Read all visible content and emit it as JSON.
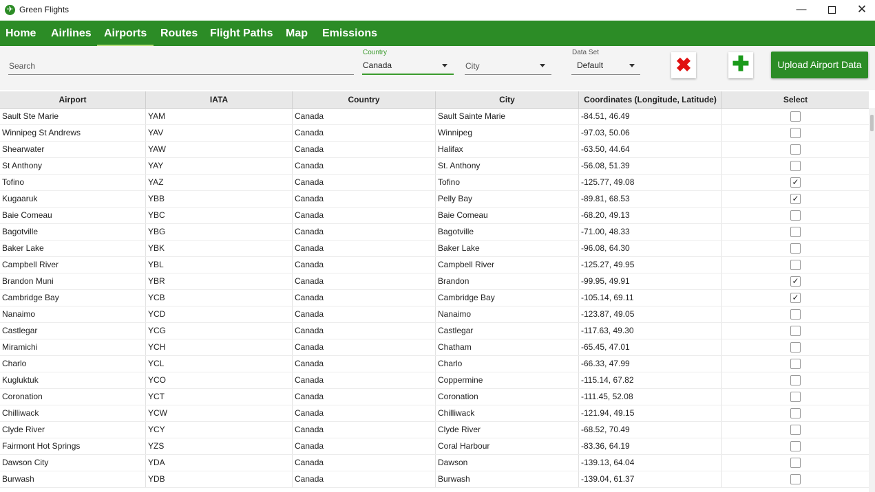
{
  "window": {
    "title": "Green Flights",
    "minimize": "—",
    "close": "✕"
  },
  "nav": {
    "tabs": [
      {
        "label": "Home"
      },
      {
        "label": "Airlines"
      },
      {
        "label": "Airports"
      },
      {
        "label": "Routes"
      },
      {
        "label": "Flight Paths"
      },
      {
        "label": "Map"
      },
      {
        "label": "Emissions"
      }
    ],
    "active": "Airports",
    "accent_color": "#2c8c26"
  },
  "filters": {
    "search_placeholder": "Search",
    "country_label": "Country",
    "country_value": "Canada",
    "city_placeholder": "City",
    "dataset_label": "Data Set",
    "dataset_value": "Default",
    "clear_icon": "✖",
    "add_icon": "✚",
    "upload_label": "Upload Airport Data"
  },
  "table": {
    "columns": [
      "Airport",
      "IATA",
      "Country",
      "City",
      "Coordinates (Longitude, Latitude)",
      "Select"
    ],
    "rows": [
      {
        "airport": "Sault Ste Marie",
        "iata": "YAM",
        "country": "Canada",
        "city": "Sault Sainte Marie",
        "coords": "-84.51, 46.49",
        "selected": false
      },
      {
        "airport": "Winnipeg St Andrews",
        "iata": "YAV",
        "country": "Canada",
        "city": "Winnipeg",
        "coords": "-97.03, 50.06",
        "selected": false
      },
      {
        "airport": "Shearwater",
        "iata": "YAW",
        "country": "Canada",
        "city": "Halifax",
        "coords": "-63.50, 44.64",
        "selected": false
      },
      {
        "airport": "St Anthony",
        "iata": "YAY",
        "country": "Canada",
        "city": "St. Anthony",
        "coords": "-56.08, 51.39",
        "selected": false
      },
      {
        "airport": "Tofino",
        "iata": "YAZ",
        "country": "Canada",
        "city": "Tofino",
        "coords": "-125.77, 49.08",
        "selected": true
      },
      {
        "airport": "Kugaaruk",
        "iata": "YBB",
        "country": "Canada",
        "city": "Pelly Bay",
        "coords": "-89.81, 68.53",
        "selected": true
      },
      {
        "airport": "Baie Comeau",
        "iata": "YBC",
        "country": "Canada",
        "city": "Baie Comeau",
        "coords": "-68.20, 49.13",
        "selected": false
      },
      {
        "airport": "Bagotville",
        "iata": "YBG",
        "country": "Canada",
        "city": "Bagotville",
        "coords": "-71.00, 48.33",
        "selected": false
      },
      {
        "airport": "Baker Lake",
        "iata": "YBK",
        "country": "Canada",
        "city": "Baker Lake",
        "coords": "-96.08, 64.30",
        "selected": false
      },
      {
        "airport": "Campbell River",
        "iata": "YBL",
        "country": "Canada",
        "city": "Campbell River",
        "coords": "-125.27, 49.95",
        "selected": false
      },
      {
        "airport": "Brandon Muni",
        "iata": "YBR",
        "country": "Canada",
        "city": "Brandon",
        "coords": "-99.95, 49.91",
        "selected": true
      },
      {
        "airport": "Cambridge Bay",
        "iata": "YCB",
        "country": "Canada",
        "city": "Cambridge Bay",
        "coords": "-105.14, 69.11",
        "selected": true
      },
      {
        "airport": "Nanaimo",
        "iata": "YCD",
        "country": "Canada",
        "city": "Nanaimo",
        "coords": "-123.87, 49.05",
        "selected": false
      },
      {
        "airport": "Castlegar",
        "iata": "YCG",
        "country": "Canada",
        "city": "Castlegar",
        "coords": "-117.63, 49.30",
        "selected": false
      },
      {
        "airport": "Miramichi",
        "iata": "YCH",
        "country": "Canada",
        "city": "Chatham",
        "coords": "-65.45, 47.01",
        "selected": false
      },
      {
        "airport": "Charlo",
        "iata": "YCL",
        "country": "Canada",
        "city": "Charlo",
        "coords": "-66.33, 47.99",
        "selected": false
      },
      {
        "airport": "Kugluktuk",
        "iata": "YCO",
        "country": "Canada",
        "city": "Coppermine",
        "coords": "-115.14, 67.82",
        "selected": false
      },
      {
        "airport": "Coronation",
        "iata": "YCT",
        "country": "Canada",
        "city": "Coronation",
        "coords": "-111.45, 52.08",
        "selected": false
      },
      {
        "airport": "Chilliwack",
        "iata": "YCW",
        "country": "Canada",
        "city": "Chilliwack",
        "coords": "-121.94, 49.15",
        "selected": false
      },
      {
        "airport": "Clyde River",
        "iata": "YCY",
        "country": "Canada",
        "city": "Clyde River",
        "coords": "-68.52, 70.49",
        "selected": false
      },
      {
        "airport": "Fairmont Hot Springs",
        "iata": "YZS",
        "country": "Canada",
        "city": "Coral Harbour",
        "coords": "-83.36, 64.19",
        "selected": false
      },
      {
        "airport": "Dawson City",
        "iata": "YDA",
        "country": "Canada",
        "city": "Dawson",
        "coords": "-139.13, 64.04",
        "selected": false
      },
      {
        "airport": "Burwash",
        "iata": "YDB",
        "country": "Canada",
        "city": "Burwash",
        "coords": "-139.04, 61.37",
        "selected": false
      }
    ]
  }
}
